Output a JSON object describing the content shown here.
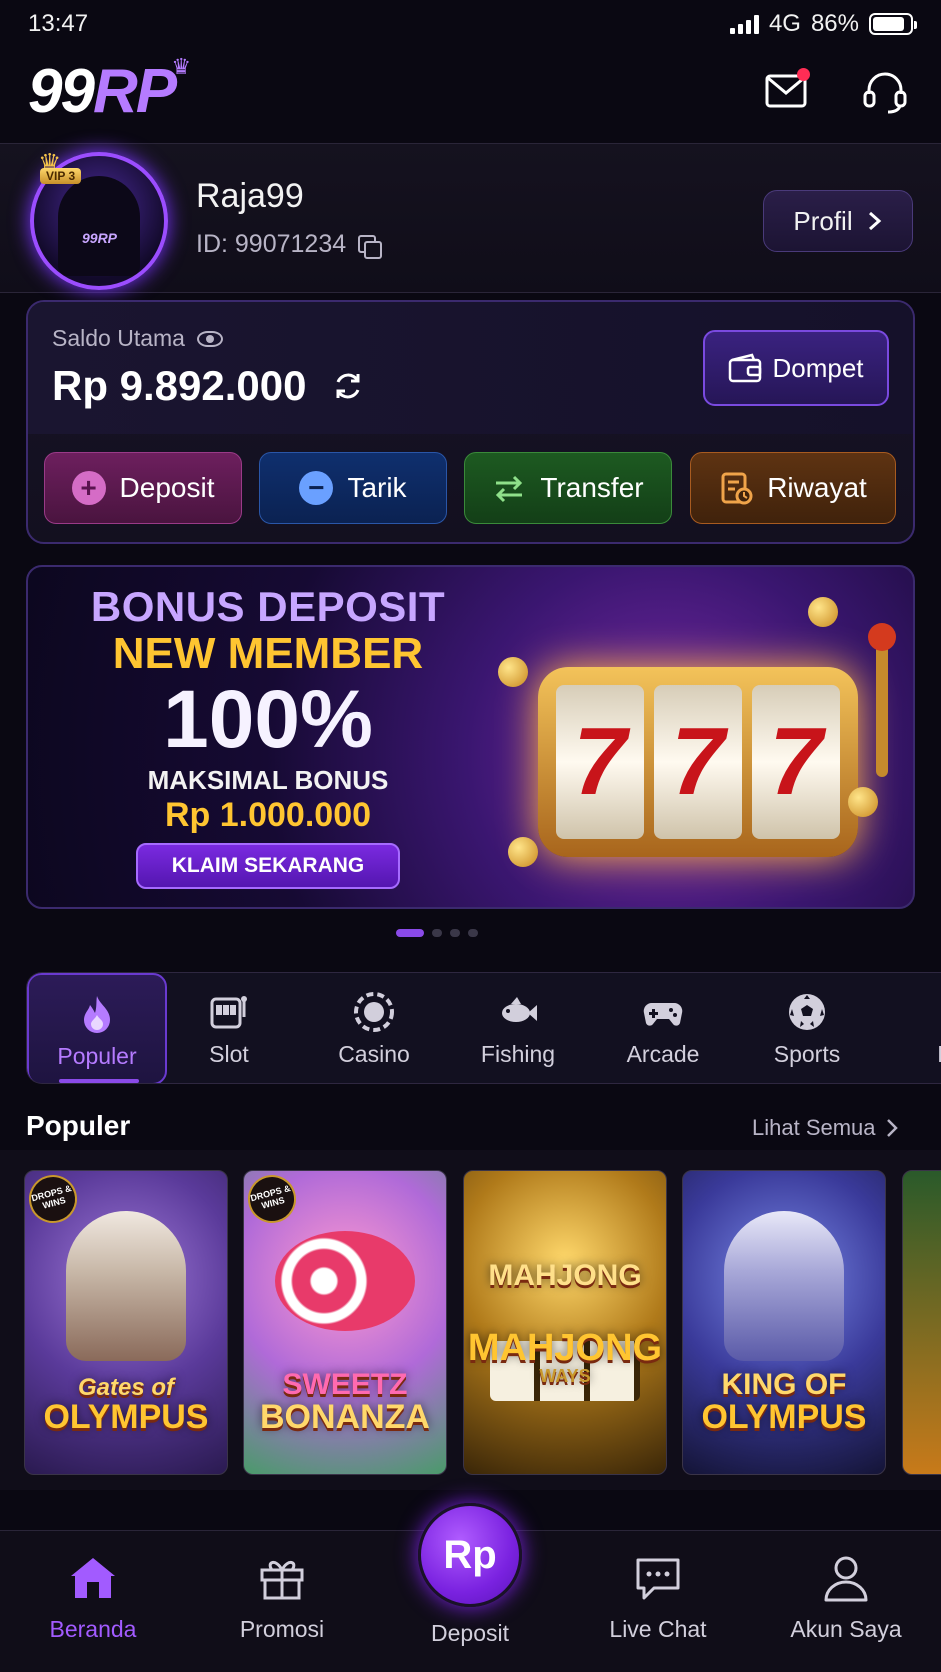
{
  "status_bar": {
    "time": "13:47",
    "network": "4G",
    "battery": "86%",
    "battery_level": 0.86
  },
  "header": {
    "logo_main": "99",
    "logo_accent": "RP",
    "icons": [
      "mail-icon",
      "headset-icon"
    ],
    "has_unread_mail": true
  },
  "profile": {
    "vip_label": "VIP 3",
    "avatar_text": "99RP",
    "username": "Raja99",
    "id_text": "ID: 99071234",
    "profile_button": "Profil"
  },
  "balance": {
    "label": "Saldo Utama",
    "amount": "Rp 9.892.000",
    "wallet_button": "Dompet"
  },
  "actions": [
    {
      "label": "Deposit",
      "icon": "plus-icon",
      "color": "#6d1f5e"
    },
    {
      "label": "Tarik",
      "icon": "minus-icon",
      "color": "#0f2f6e"
    },
    {
      "label": "Transfer",
      "icon": "transfer-icon",
      "color": "#1d5a21"
    },
    {
      "label": "Riwayat",
      "icon": "history-icon",
      "color": "#5e3312"
    }
  ],
  "banner": {
    "line1": "BONUS DEPOSIT",
    "line2": "NEW MEMBER",
    "line3": "100%",
    "line4": "MAKSIMAL BONUS",
    "line5": "Rp 1.000.000",
    "cta": "KLAIM SEKARANG",
    "reel_symbols": [
      "7",
      "7",
      "7"
    ],
    "active_slide": 1,
    "slide_count": 4
  },
  "categories": [
    {
      "label": "Populer",
      "icon": "fire-icon",
      "active": true
    },
    {
      "label": "Slot",
      "icon": "slot-machine-icon",
      "active": false
    },
    {
      "label": "Casino",
      "icon": "casino-chip-icon",
      "active": false
    },
    {
      "label": "Fishing",
      "icon": "fish-icon",
      "active": false
    },
    {
      "label": "Arcade",
      "icon": "gamepad-icon",
      "active": false
    },
    {
      "label": "Sports",
      "icon": "soccer-ball-icon",
      "active": false
    },
    {
      "label": "Re",
      "icon": "",
      "active": false
    }
  ],
  "games_section": {
    "title": "Populer",
    "see_all": "Lihat Semua",
    "games": [
      {
        "title_line1": "Gates of",
        "title_line2": "OLYMPUS",
        "badge": "DROPS & WINS"
      },
      {
        "title_line1": "SWEETZ",
        "title_line2": "BONANZA",
        "badge": "DROPS & WINS"
      },
      {
        "title_line1": "MAHJONG",
        "title_line2": "MAHJONG",
        "title_line3": "WAYS",
        "badge": ""
      },
      {
        "title_line1": "KING OF",
        "title_line2": "OLYMPUS",
        "badge": ""
      }
    ]
  },
  "bottom_nav": {
    "items": [
      {
        "label": "Beranda",
        "icon": "home-icon",
        "active": true
      },
      {
        "label": "Promosi",
        "icon": "gift-icon",
        "active": false
      },
      {
        "label": "Deposit",
        "icon": "rp-icon",
        "active": false,
        "fab_text": "Rp"
      },
      {
        "label": "Live Chat",
        "icon": "chat-icon",
        "active": false
      },
      {
        "label": "Akun Saya",
        "icon": "user-icon",
        "active": false
      }
    ]
  },
  "colors": {
    "accent": "#8a4ae8",
    "background": "#0a0812",
    "gold": "#ffc531"
  }
}
